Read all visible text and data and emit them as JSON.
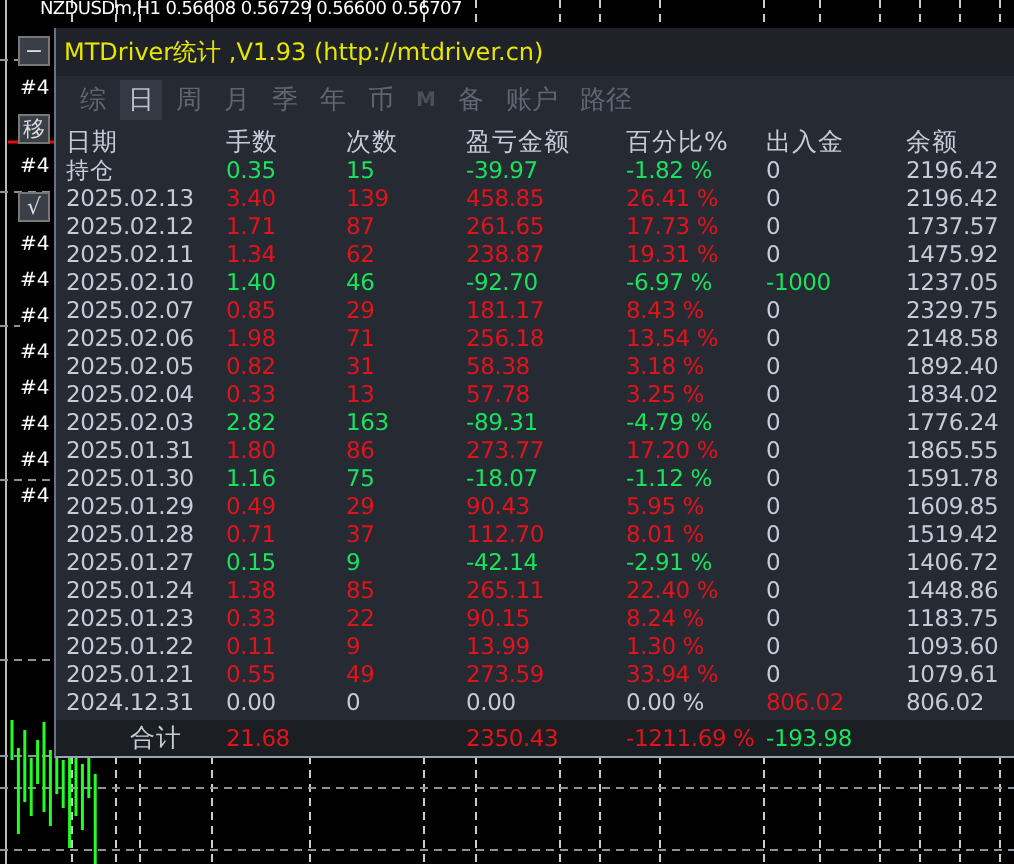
{
  "chart_header": "NZDUSDm,H1  0.56608 0.56729 0.56600 0.56707",
  "side_buttons": [
    "−",
    "移",
    "√"
  ],
  "order_labels": [
    "#4",
    "#4",
    "#4",
    "#4",
    "#4",
    "#4",
    "#4",
    "#4",
    "#4",
    "#4"
  ],
  "panel": {
    "title": "MTDriver统计 ,V1.93 (http://mtdriver.cn)",
    "tabs": [
      {
        "label": "综",
        "selected": false,
        "kind": "text"
      },
      {
        "label": "日",
        "selected": true,
        "kind": "text"
      },
      {
        "label": "周",
        "selected": false,
        "kind": "text"
      },
      {
        "label": "月",
        "selected": false,
        "kind": "text"
      },
      {
        "label": "季",
        "selected": false,
        "kind": "text"
      },
      {
        "label": "年",
        "selected": false,
        "kind": "text"
      },
      {
        "label": "币",
        "selected": false,
        "kind": "text"
      },
      {
        "label": "M",
        "selected": false,
        "kind": "mark"
      },
      {
        "label": "备",
        "selected": false,
        "kind": "text"
      },
      {
        "label": "账户",
        "selected": false,
        "kind": "text"
      },
      {
        "label": "路径",
        "selected": false,
        "kind": "text"
      }
    ],
    "columns": [
      "日期",
      "手数",
      "次数",
      "盈亏金额",
      "百分比%",
      "出入金",
      "余额"
    ],
    "rows": [
      {
        "date": "持仓",
        "lots": "0.35",
        "trades": "15",
        "profit": "-39.97",
        "percent": "-1.82 %",
        "deposit": {
          "text": "0",
          "color": "#c4ccd8"
        },
        "balance": "2196.42",
        "color": "#19e35d"
      },
      {
        "date": "2025.02.13",
        "lots": "3.40",
        "trades": "139",
        "profit": "458.85",
        "percent": "26.41 %",
        "deposit": {
          "text": "0",
          "color": "#c4ccd8"
        },
        "balance": "2196.42",
        "color": "#e0141b"
      },
      {
        "date": "2025.02.12",
        "lots": "1.71",
        "trades": "87",
        "profit": "261.65",
        "percent": "17.73 %",
        "deposit": {
          "text": "0",
          "color": "#c4ccd8"
        },
        "balance": "1737.57",
        "color": "#e0141b"
      },
      {
        "date": "2025.02.11",
        "lots": "1.34",
        "trades": "62",
        "profit": "238.87",
        "percent": "19.31 %",
        "deposit": {
          "text": "0",
          "color": "#c4ccd8"
        },
        "balance": "1475.92",
        "color": "#e0141b"
      },
      {
        "date": "2025.02.10",
        "lots": "1.40",
        "trades": "46",
        "profit": "-92.70",
        "percent": "-6.97 %",
        "deposit": {
          "text": "-1000",
          "color": "#19e35d"
        },
        "balance": "1237.05",
        "color": "#19e35d"
      },
      {
        "date": "2025.02.07",
        "lots": "0.85",
        "trades": "29",
        "profit": "181.17",
        "percent": "8.43 %",
        "deposit": {
          "text": "0",
          "color": "#c4ccd8"
        },
        "balance": "2329.75",
        "color": "#e0141b"
      },
      {
        "date": "2025.02.06",
        "lots": "1.98",
        "trades": "71",
        "profit": "256.18",
        "percent": "13.54 %",
        "deposit": {
          "text": "0",
          "color": "#c4ccd8"
        },
        "balance": "2148.58",
        "color": "#e0141b"
      },
      {
        "date": "2025.02.05",
        "lots": "0.82",
        "trades": "31",
        "profit": "58.38",
        "percent": "3.18 %",
        "deposit": {
          "text": "0",
          "color": "#c4ccd8"
        },
        "balance": "1892.40",
        "color": "#e0141b"
      },
      {
        "date": "2025.02.04",
        "lots": "0.33",
        "trades": "13",
        "profit": "57.78",
        "percent": "3.25 %",
        "deposit": {
          "text": "0",
          "color": "#c4ccd8"
        },
        "balance": "1834.02",
        "color": "#e0141b"
      },
      {
        "date": "2025.02.03",
        "lots": "2.82",
        "trades": "163",
        "profit": "-89.31",
        "percent": "-4.79 %",
        "deposit": {
          "text": "0",
          "color": "#c4ccd8"
        },
        "balance": "1776.24",
        "color": "#19e35d"
      },
      {
        "date": "2025.01.31",
        "lots": "1.80",
        "trades": "86",
        "profit": "273.77",
        "percent": "17.20 %",
        "deposit": {
          "text": "0",
          "color": "#c4ccd8"
        },
        "balance": "1865.55",
        "color": "#e0141b"
      },
      {
        "date": "2025.01.30",
        "lots": "1.16",
        "trades": "75",
        "profit": "-18.07",
        "percent": "-1.12 %",
        "deposit": {
          "text": "0",
          "color": "#c4ccd8"
        },
        "balance": "1591.78",
        "color": "#19e35d"
      },
      {
        "date": "2025.01.29",
        "lots": "0.49",
        "trades": "29",
        "profit": "90.43",
        "percent": "5.95 %",
        "deposit": {
          "text": "0",
          "color": "#c4ccd8"
        },
        "balance": "1609.85",
        "color": "#e0141b"
      },
      {
        "date": "2025.01.28",
        "lots": "0.71",
        "trades": "37",
        "profit": "112.70",
        "percent": "8.01 %",
        "deposit": {
          "text": "0",
          "color": "#c4ccd8"
        },
        "balance": "1519.42",
        "color": "#e0141b"
      },
      {
        "date": "2025.01.27",
        "lots": "0.15",
        "trades": "9",
        "profit": "-42.14",
        "percent": "-2.91 %",
        "deposit": {
          "text": "0",
          "color": "#c4ccd8"
        },
        "balance": "1406.72",
        "color": "#19e35d"
      },
      {
        "date": "2025.01.24",
        "lots": "1.38",
        "trades": "85",
        "profit": "265.11",
        "percent": "22.40 %",
        "deposit": {
          "text": "0",
          "color": "#c4ccd8"
        },
        "balance": "1448.86",
        "color": "#e0141b"
      },
      {
        "date": "2025.01.23",
        "lots": "0.33",
        "trades": "22",
        "profit": "90.15",
        "percent": "8.24 %",
        "deposit": {
          "text": "0",
          "color": "#c4ccd8"
        },
        "balance": "1183.75",
        "color": "#e0141b"
      },
      {
        "date": "2025.01.22",
        "lots": "0.11",
        "trades": "9",
        "profit": "13.99",
        "percent": "1.30 %",
        "deposit": {
          "text": "0",
          "color": "#c4ccd8"
        },
        "balance": "1093.60",
        "color": "#e0141b"
      },
      {
        "date": "2025.01.21",
        "lots": "0.55",
        "trades": "49",
        "profit": "273.59",
        "percent": "33.94 %",
        "deposit": {
          "text": "0",
          "color": "#c4ccd8"
        },
        "balance": "1079.61",
        "color": "#e0141b"
      },
      {
        "date": "2024.12.31",
        "lots": "0.00",
        "trades": "0",
        "profit": "0.00",
        "percent": "0.00 %",
        "deposit": {
          "text": "806.02",
          "color": "#e0141b"
        },
        "balance": "806.02",
        "color": "#c4ccd8"
      }
    ],
    "total": {
      "label": "合计",
      "lots": {
        "text": "21.68",
        "color": "#e0141b"
      },
      "profit": {
        "text": "2350.43",
        "color": "#e0141b"
      },
      "percent": {
        "text": "-1211.69 %",
        "color": "#e0141b"
      },
      "deposit": {
        "text": "-193.98",
        "color": "#19e35d"
      }
    }
  }
}
